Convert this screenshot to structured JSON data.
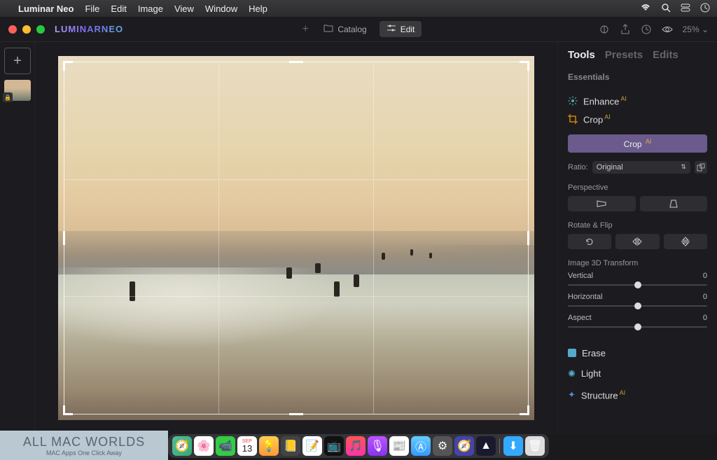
{
  "menubar": {
    "app_name": "Luminar Neo",
    "items": [
      "File",
      "Edit",
      "Image",
      "View",
      "Window",
      "Help"
    ]
  },
  "titlebar": {
    "logo": "LUMINARNEO",
    "catalog_label": "Catalog",
    "edit_label": "Edit",
    "zoom": "25% ⌄"
  },
  "panel": {
    "tabs": {
      "tools": "Tools",
      "presets": "Presets",
      "edits": "Edits"
    },
    "essentials": "Essentials",
    "enhance": "Enhance",
    "crop": "Crop",
    "crop_btn": "Crop",
    "ratio_label": "Ratio:",
    "ratio_value": "Original",
    "perspective": "Perspective",
    "rotate_flip": "Rotate & Flip",
    "transform": "Image 3D Transform",
    "vertical": "Vertical",
    "horizontal": "Horizontal",
    "aspect": "Aspect",
    "vertical_val": "0",
    "horizontal_val": "0",
    "aspect_val": "0",
    "erase": "Erase",
    "light": "Light",
    "structure": "Structure"
  },
  "watermark": {
    "main": "ALL MAC WORLDS",
    "sub": "MAC Apps One Click Away"
  }
}
